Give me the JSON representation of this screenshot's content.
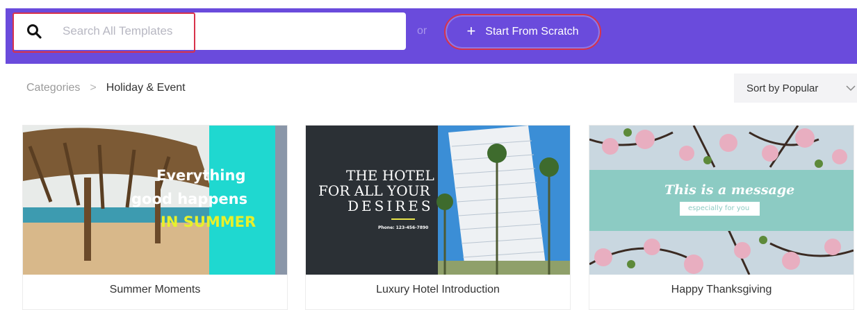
{
  "search": {
    "placeholder": "Search All Templates",
    "value": ""
  },
  "or_label": "or",
  "scratch_button": {
    "icon": "plus-icon",
    "label": "Start From Scratch"
  },
  "breadcrumb": {
    "root": "Categories",
    "separator": ">",
    "current": "Holiday & Event"
  },
  "sort": {
    "selected": "Sort by Popular"
  },
  "colors": {
    "topbar": "#6a4bdc",
    "highlight": "#d8324a",
    "teal": "#1fd8d0",
    "hotel_dark": "#2b3035",
    "message_band": "#8ccbc3"
  },
  "templates": [
    {
      "title": "Summer Moments",
      "thumb_lines": [
        "Everything",
        "good happens",
        "IN SUMMER"
      ]
    },
    {
      "title": "Luxury Hotel Introduction",
      "thumb_lines": [
        "THE HOTEL",
        "FOR ALL YOUR",
        "DESIRES"
      ],
      "thumb_small": "Phone: 123-456-7890"
    },
    {
      "title": "Happy Thanksgiving",
      "thumb_lines": [
        "This is a message",
        "especially for you"
      ]
    }
  ]
}
